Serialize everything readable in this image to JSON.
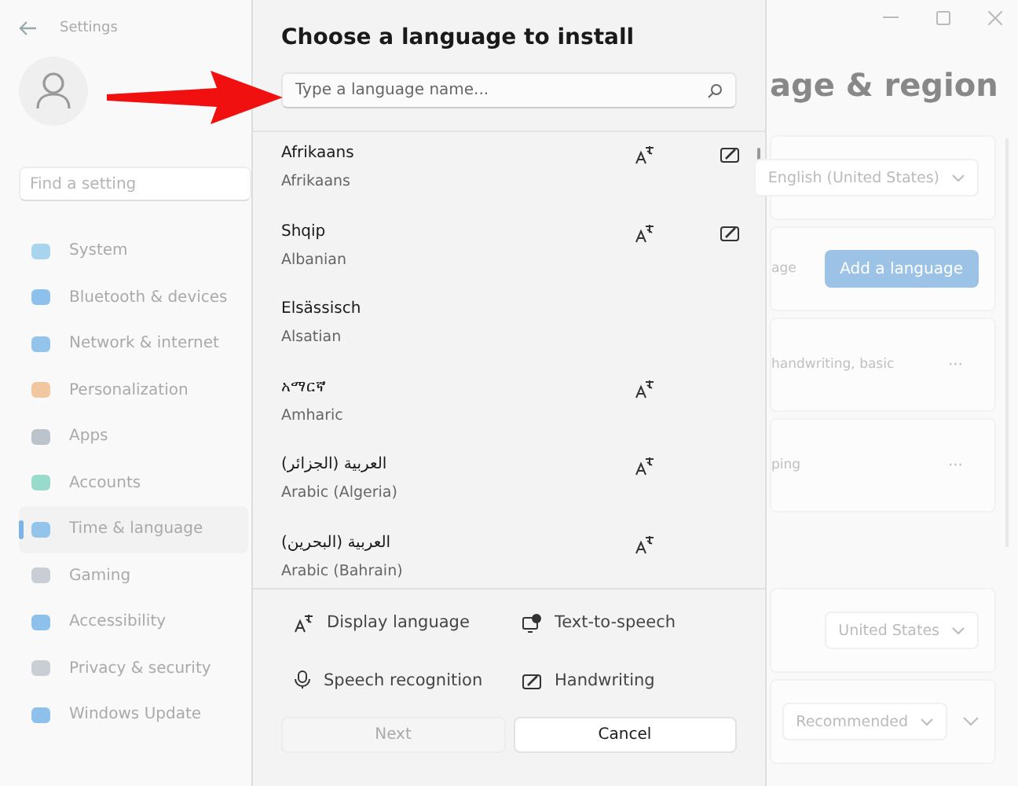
{
  "window": {
    "title": "Settings"
  },
  "sidebar": {
    "search": {
      "placeholder": "Find a setting"
    },
    "items": [
      {
        "label": "System",
        "color": "#a8d4ee",
        "selected": false
      },
      {
        "label": "Bluetooth & devices",
        "color": "#8ec0ec",
        "selected": false
      },
      {
        "label": "Network & internet",
        "color": "#94c4ea",
        "selected": false
      },
      {
        "label": "Personalization",
        "color": "#f0c79e",
        "selected": false
      },
      {
        "label": "Apps",
        "color": "#bcc3ca",
        "selected": false
      },
      {
        "label": "Accounts",
        "color": "#98dbcc",
        "selected": false
      },
      {
        "label": "Time & language",
        "color": "#94c4ea",
        "selected": true
      },
      {
        "label": "Gaming",
        "color": "#c8ced4",
        "selected": false
      },
      {
        "label": "Accessibility",
        "color": "#8ec0ec",
        "selected": false
      },
      {
        "label": "Privacy & security",
        "color": "#c8ced4",
        "selected": false
      },
      {
        "label": "Windows Update",
        "color": "#8ec0ec",
        "selected": false
      }
    ]
  },
  "page": {
    "title": "age & region",
    "cards": [
      {
        "kind": "dropdown",
        "value": "English (United States)"
      },
      {
        "kind": "button",
        "text": "age",
        "button": "Add a language"
      },
      {
        "kind": "more",
        "text": "handwriting, basic",
        "more": "···"
      },
      {
        "kind": "more",
        "text": "ping",
        "more": "···"
      },
      {
        "kind": "gap"
      },
      {
        "kind": "dropdown",
        "value": "United States"
      },
      {
        "kind": "dropdown",
        "value": "Recommended",
        "expander": true
      }
    ]
  },
  "dialog": {
    "title": "Choose a language to install",
    "search": {
      "placeholder": "Type a language name..."
    },
    "languages": [
      {
        "native": "Afrikaans",
        "english": "Afrikaans",
        "display_language": true,
        "handwriting": true
      },
      {
        "native": "Shqip",
        "english": "Albanian",
        "display_language": true,
        "handwriting": true
      },
      {
        "native": "Elsässisch",
        "english": "Alsatian",
        "display_language": false,
        "handwriting": false
      },
      {
        "native": "አማርኛ",
        "english": "Amharic",
        "display_language": true,
        "handwriting": false
      },
      {
        "native": "العربية (الجزائر)",
        "english": "Arabic (Algeria)",
        "display_language": true,
        "handwriting": false
      },
      {
        "native": "العربية (البحرين)",
        "english": "Arabic (Bahrain)",
        "display_language": true,
        "handwriting": false
      }
    ],
    "legend": [
      {
        "kind": "display",
        "label": "Display language"
      },
      {
        "kind": "tts",
        "label": "Text-to-speech"
      },
      {
        "kind": "speech",
        "label": "Speech recognition"
      },
      {
        "kind": "handwriting",
        "label": "Handwriting"
      }
    ],
    "buttons": [
      {
        "label": "Next",
        "disabled": true
      },
      {
        "label": "Cancel",
        "disabled": false
      }
    ]
  }
}
